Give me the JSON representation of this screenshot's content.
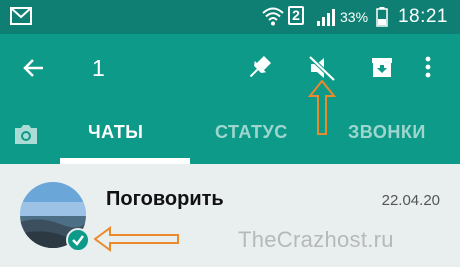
{
  "status_bar": {
    "battery_percent": "33%",
    "time": "18:21",
    "sim_label": "2",
    "icons": [
      "gmail-icon",
      "wifi-icon",
      "signal-icon",
      "battery-icon"
    ]
  },
  "toolbar": {
    "selected_count": "1",
    "actions": [
      "back-arrow-icon",
      "pin-icon",
      "mute-icon",
      "archive-icon",
      "more-vert-icon"
    ]
  },
  "tabs": {
    "camera_icon": "camera-icon",
    "items": [
      {
        "label": "ЧАТЫ",
        "active": true
      },
      {
        "label": "СТАТУС",
        "active": false
      },
      {
        "label": "ЗВОНКИ",
        "active": false
      }
    ]
  },
  "chat": {
    "name": "Поговорить",
    "date": "22.04.20",
    "selected": true
  },
  "watermark": "TheCrazhost.ru",
  "colors": {
    "status_bar": "#0f7f73",
    "toolbar": "#0e9a88",
    "row_selected": "#e9eeee",
    "annotation_arrow": "#e98a2c"
  }
}
